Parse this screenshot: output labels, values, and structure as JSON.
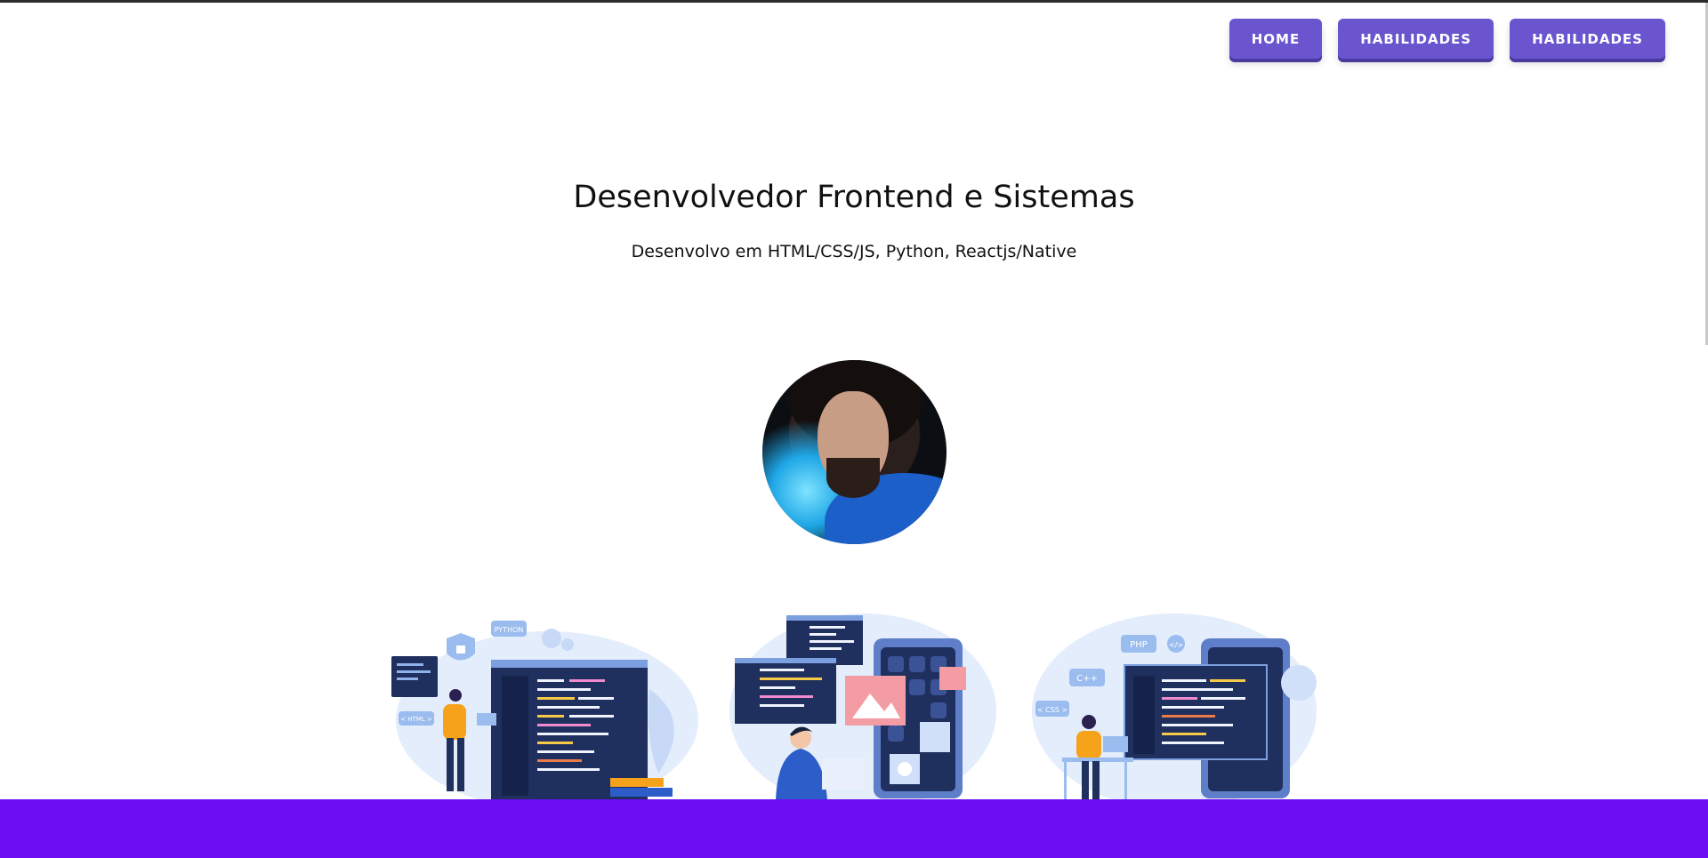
{
  "nav": {
    "items": [
      {
        "label": "HOME"
      },
      {
        "label": "HABILIDADES"
      },
      {
        "label": "HABILIDADES"
      }
    ]
  },
  "hero": {
    "title": "Desenvolvedor Frontend e Sistemas",
    "subtitle": "Desenvolvo em HTML/CSS/JS, Python, Reactjs/Native"
  },
  "illustrations": {
    "one": {
      "tags": [
        "PYTHON",
        "< HTML >"
      ]
    },
    "three": {
      "tags": [
        "PHP",
        "C++",
        "< CSS >",
        "</>"
      ]
    }
  },
  "colors": {
    "nav_button": "#6a55cf",
    "footer": "#6b0cf2",
    "illustration_dark": "#1f2f5e",
    "illustration_light": "#dbe8fb"
  }
}
